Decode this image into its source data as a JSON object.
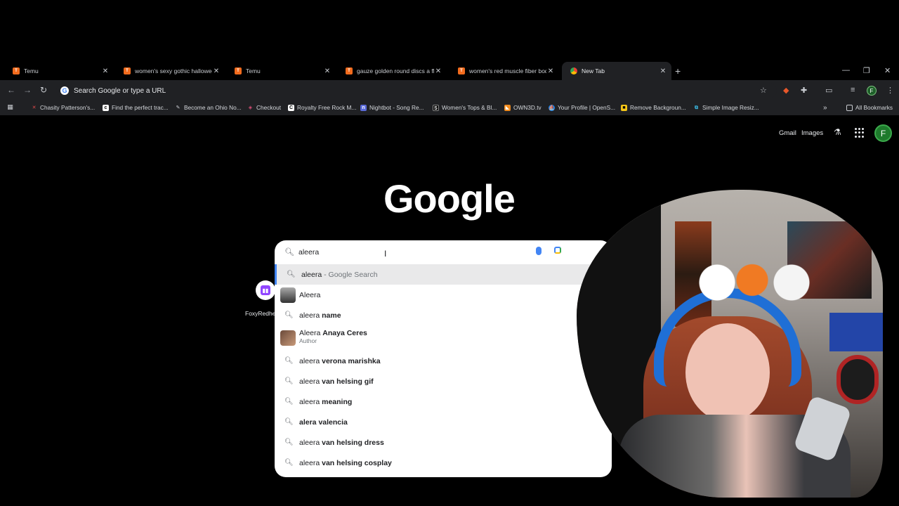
{
  "tabs": [
    {
      "title": "Temu",
      "fav": "temu-icon"
    },
    {
      "title": "women's sexy gothic halloween",
      "fav": "temu-icon"
    },
    {
      "title": "Temu",
      "fav": "temu-icon"
    },
    {
      "title": "gauze golden round discs a flo",
      "fav": "temu-icon"
    },
    {
      "title": "women's red muscle fiber body",
      "fav": "temu-icon"
    },
    {
      "title": "New Tab",
      "fav": "chrome-icon",
      "active": true
    }
  ],
  "toolbar": {
    "omnibox_placeholder": "Search Google or type a URL",
    "profile_initial": "F"
  },
  "bookmarks": [
    "Chasity Patterson's...",
    "Find the perfect trac...",
    "Become an Ohio No...",
    "Checkout",
    "Royalty Free Rock M...",
    "Nightbot - Song Re...",
    "Women's Tops & Bl...",
    "OWN3D.tv",
    "Your Profile | OpenS...",
    "Remove Backgroun...",
    "Simple Image Resiz..."
  ],
  "all_bookmarks": "All Bookmarks",
  "page": {
    "gmail": "Gmail",
    "images": "Images",
    "account_initial": "F",
    "logo": "Google",
    "shortcut_label": "FoxyRedhe"
  },
  "search": {
    "query": "aleera",
    "suggestions": [
      {
        "prefix": "aleera",
        "bold": "",
        "suffix": " - Google Search",
        "type": "search",
        "selected": true
      },
      {
        "prefix": "Aleera",
        "bold": "",
        "suffix": "",
        "type": "entity"
      },
      {
        "prefix": "aleera ",
        "bold": "name",
        "suffix": "",
        "type": "search"
      },
      {
        "prefix": "Aleera ",
        "bold": "Anaya Ceres",
        "suffix": "",
        "sub": "Author",
        "type": "entity"
      },
      {
        "prefix": "aleera ",
        "bold": "verona marishka",
        "suffix": "",
        "type": "search"
      },
      {
        "prefix": "aleera ",
        "bold": "van helsing gif",
        "suffix": "",
        "type": "search"
      },
      {
        "prefix": "aleera ",
        "bold": "meaning",
        "suffix": "",
        "type": "search"
      },
      {
        "prefix": "",
        "bold": "alera valencia",
        "suffix": "",
        "type": "search"
      },
      {
        "prefix": "aleera ",
        "bold": "van helsing dress",
        "suffix": "",
        "type": "search"
      },
      {
        "prefix": "aleera ",
        "bold": "van helsing cosplay",
        "suffix": "",
        "type": "search"
      }
    ]
  },
  "colors": {
    "accent": "#4285f4",
    "temu": "#f26b1d",
    "twitch": "#9146ff"
  }
}
